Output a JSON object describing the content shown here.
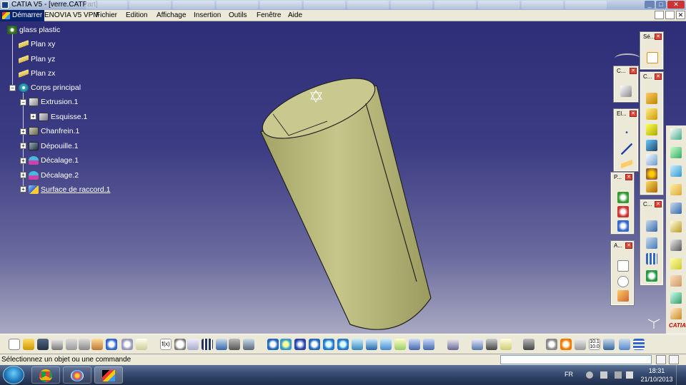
{
  "window": {
    "title": "CATIA V5 - [verre.CATPart]"
  },
  "menubar": {
    "items": [
      "Démarrer",
      "ENOVIA V5 VPM",
      "Fichier",
      "Edition",
      "Affichage",
      "Insertion",
      "Outils",
      "Fenêtre",
      "Aide"
    ]
  },
  "tree": {
    "root": "glass plastic",
    "planes": [
      "Plan xy",
      "Plan yz",
      "Plan zx"
    ],
    "body": "Corps principal",
    "features": [
      {
        "label": "Extrusion.1",
        "icon": "extrusion-icon"
      },
      {
        "label": "Esquisse.1",
        "icon": "sketch-icon"
      },
      {
        "label": "Chanfrein.1",
        "icon": "chamfer-icon"
      },
      {
        "label": "Dépouille.1",
        "icon": "draft-icon"
      },
      {
        "label": "Décalage.1",
        "icon": "offset-icon"
      },
      {
        "label": "Décalage.2",
        "icon": "offset-icon"
      },
      {
        "label": "Surface de raccord.1",
        "icon": "fillet-surface-icon"
      }
    ]
  },
  "floating_toolbars": [
    {
      "title": "Sé..."
    },
    {
      "title": "C..."
    },
    {
      "title": "C..."
    },
    {
      "title": "El..."
    },
    {
      "title": "P..."
    },
    {
      "title": "C..."
    },
    {
      "title": "A..."
    }
  ],
  "status": {
    "message": "Sélectionnez un objet ou une commande"
  },
  "taskbar": {
    "language": "FR",
    "time": "18:31",
    "date": "21/10/2013"
  },
  "colors": {
    "part_fill": "#b5b574",
    "viewport_top": "#2e2e78",
    "viewport_bottom": "#a9a9c2"
  }
}
